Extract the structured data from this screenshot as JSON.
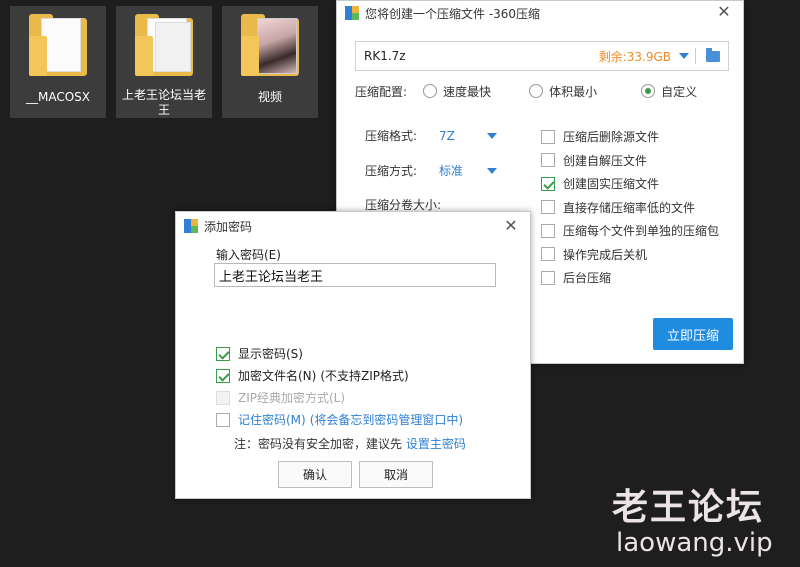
{
  "desktop": {
    "items": [
      {
        "label": "__MACOSX"
      },
      {
        "label": "上老王论坛当老王"
      },
      {
        "label": "视频"
      }
    ]
  },
  "main_window": {
    "title": "您将创建一个压缩文件 -360压缩",
    "path_value": "RK1.7z",
    "free_space": "剩余:33.9GB",
    "config_label": "压缩配置:",
    "config_options": [
      {
        "label": "速度最快",
        "selected": false
      },
      {
        "label": "体积最小",
        "selected": false
      },
      {
        "label": "自定义",
        "selected": true
      }
    ],
    "format_label": "压缩格式:",
    "format_value": "7Z",
    "method_label": "压缩方式:",
    "method_value": "标准",
    "split_label": "压缩分卷大小:",
    "checkboxes": [
      {
        "label": "压缩后删除源文件",
        "checked": false
      },
      {
        "label": "创建自解压文件",
        "checked": false
      },
      {
        "label": "创建固实压缩文件",
        "checked": true
      },
      {
        "label": "直接存储压缩率低的文件",
        "checked": false
      },
      {
        "label": "压缩每个文件到单独的压缩包",
        "checked": false
      },
      {
        "label": "操作完成后关机",
        "checked": false
      },
      {
        "label": "后台压缩",
        "checked": false
      }
    ],
    "compress_button": "立即压缩"
  },
  "password_dialog": {
    "title": "添加密码",
    "input_label": "输入密码(E)",
    "input_value": "上老王论坛当老王",
    "show_password": "显示密码(S)",
    "encrypt_names": "加密文件名(N)",
    "encrypt_names_note": "(不支持ZIP格式)",
    "zip_classic": "ZIP经典加密方式(L)",
    "remember": "记住密码(M)",
    "remember_note": "(将会备忘到密码管理窗口中)",
    "note_prefix": "注：密码没有安全加密，建议先",
    "note_link": "设置主密码",
    "ok": "确认",
    "cancel": "取消"
  },
  "watermark": {
    "title": "老王论坛",
    "url": "laowang.vip"
  },
  "colors": {
    "accent": "#1f8ce0",
    "check": "#3a9d4a",
    "space": "#f08a24",
    "desktop": "#1e1e1e"
  }
}
